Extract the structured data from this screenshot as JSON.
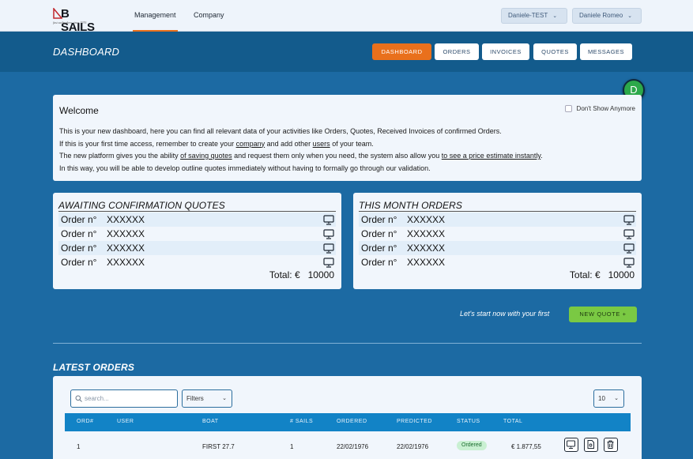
{
  "brand": {
    "name": "B SAILS",
    "tagline": "fast sailmakers since 1976"
  },
  "topnav": {
    "links": [
      {
        "label": "Management",
        "active": true
      },
      {
        "label": "Company",
        "active": false
      }
    ],
    "workspace": "Daniele-TEST",
    "user": "Daniele Romeo"
  },
  "header": {
    "title": "DASHBOARD",
    "tabs": [
      {
        "label": "DASHBOARD",
        "active": true
      },
      {
        "label": "ORDERS",
        "active": false
      },
      {
        "label": "INVOICES",
        "active": false
      },
      {
        "label": "QUOTES",
        "active": false
      },
      {
        "label": "MESSAGES",
        "active": false
      }
    ]
  },
  "avatar": {
    "initial": "D",
    "color": "#2ca84a"
  },
  "welcome": {
    "title": "Welcome",
    "dont_show": "Don't Show Anymore",
    "line1": "This is your new dashboard, here you can find all relevant data of your activities like Orders, Quotes, Received Invoices of confirmed Orders.",
    "line2_a": "If this is your first time access, remember to create your ",
    "line2_link1": "company",
    "line2_b": " and add other ",
    "line2_link2": "users",
    "line2_c": " of your team.",
    "line3_a": "The new platform gives you the ability ",
    "line3_link1": "of saving quotes",
    "line3_b": " and request them only when you need, the system also allow you ",
    "line3_link2": "to see a price estimate instantly",
    "line3_c": ".",
    "line4": "In this way, you will be able to develop outline quotes immediately without having to formally go through our validation."
  },
  "quotes_card": {
    "title": "AWAITING CONFIRMATION QUOTES",
    "rows": [
      {
        "label": "Order n°",
        "value": "XXXXXX"
      },
      {
        "label": "Order n°",
        "value": "XXXXXX"
      },
      {
        "label": "Order n°",
        "value": "XXXXXX"
      },
      {
        "label": "Order n°",
        "value": "XXXXXX"
      }
    ],
    "total_label": "Total: €",
    "total_value": "10000"
  },
  "orders_card": {
    "title": "THIS MONTH ORDERS",
    "rows": [
      {
        "label": "Order n°",
        "value": "XXXXXX"
      },
      {
        "label": "Order n°",
        "value": "XXXXXX"
      },
      {
        "label": "Order n°",
        "value": "XXXXXX"
      },
      {
        "label": "Order n°",
        "value": "XXXXXX"
      }
    ],
    "total_label": "Total: €",
    "total_value": "10000"
  },
  "cta": {
    "text": "Let's start now with your first",
    "button": "NEW QUOTE +"
  },
  "latest": {
    "title": "LATEST ORDERS",
    "search_placeholder": "search...",
    "filters_label": "Filters",
    "page_size": "10",
    "columns": [
      "ORD#",
      "USER",
      "BOAT",
      "# SAILS",
      "ORDERED",
      "PREDICTED",
      "STATUS",
      "TOTAL"
    ],
    "rows": [
      {
        "ord": "1",
        "user": "",
        "boat": "FIRST 27.7",
        "sails": "1",
        "ordered": "22/02/1976",
        "predicted": "22/02/1976",
        "status": "Ordered",
        "total": "€ 1.877,55"
      }
    ]
  },
  "icons": {
    "row_icon": "monitor-icon",
    "actions": [
      "monitor-icon",
      "document-icon",
      "trash-icon"
    ]
  },
  "colors": {
    "accent": "#e9701c",
    "primary": "#1283c6",
    "cta": "#7ac943",
    "status_ordered": "#c9f0d2"
  }
}
